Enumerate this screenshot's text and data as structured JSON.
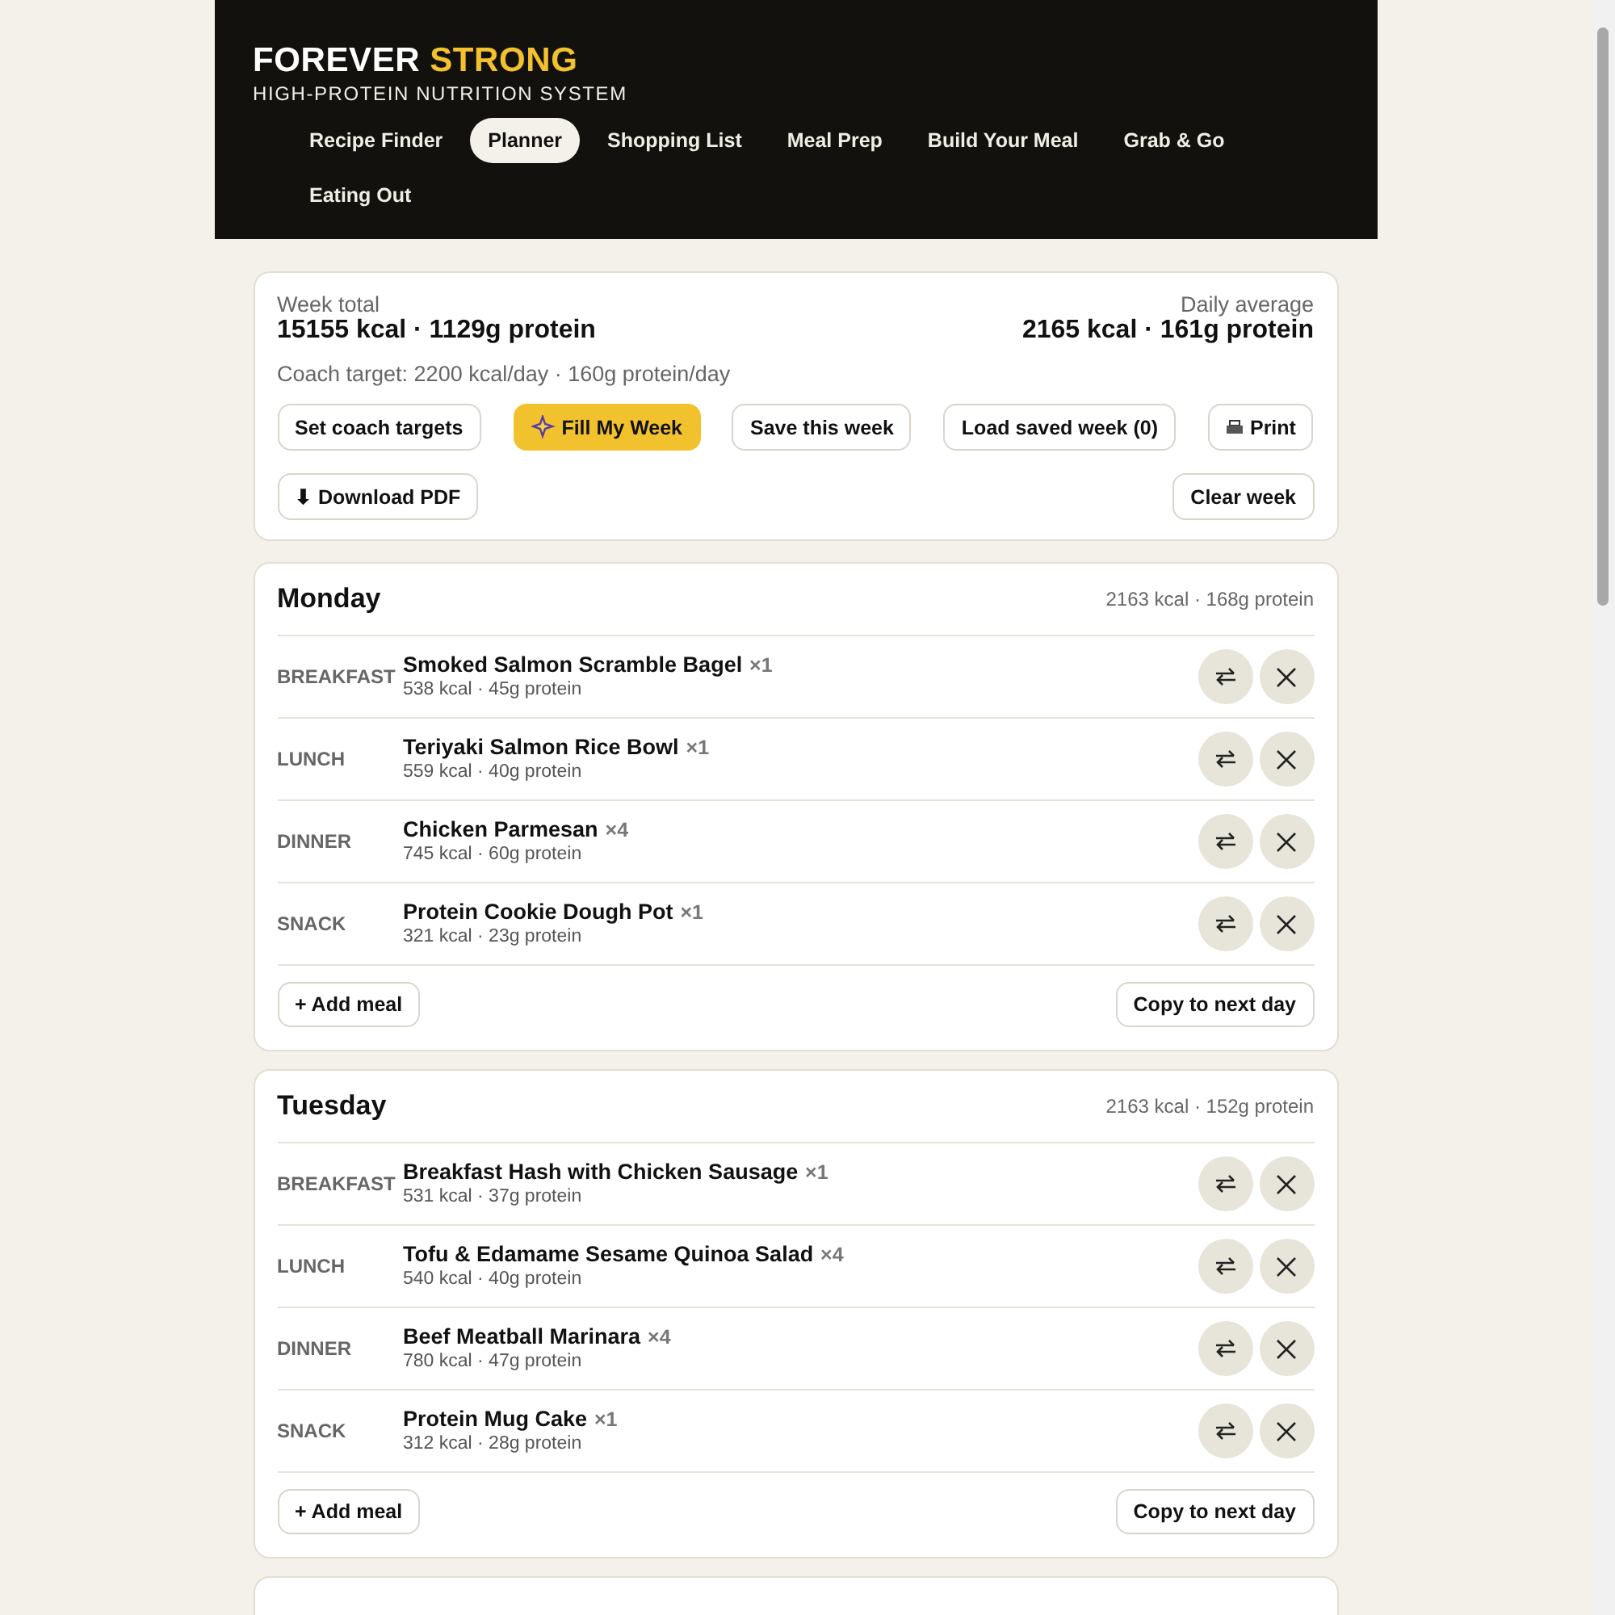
{
  "brand": {
    "title_main": "FOREVER",
    "title_accent": "STRONG",
    "tagline": "HIGH-PROTEIN NUTRITION SYSTEM"
  },
  "nav": [
    {
      "label": "Recipe Finder",
      "selected": false
    },
    {
      "label": "Planner",
      "selected": true
    },
    {
      "label": "Shopping List",
      "selected": false
    },
    {
      "label": "Meal Prep",
      "selected": false
    },
    {
      "label": "Build Your Meal",
      "selected": false
    },
    {
      "label": "Grab & Go",
      "selected": false
    },
    {
      "label": "Eating Out",
      "selected": false
    }
  ],
  "summary": {
    "week_label": "Week total",
    "week_value": "15155 kcal · 1129g protein",
    "avg_label": "Daily average",
    "avg_value": "2165 kcal · 161g protein",
    "coach_target": "Coach target: 2200 kcal/day · 160g protein/day",
    "buttons": [
      {
        "label": "Set coach targets",
        "kind": "plain"
      },
      {
        "label": "Fill My Week",
        "kind": "primary"
      },
      {
        "label": "Save this week",
        "kind": "plain"
      },
      {
        "label": "Load saved week (0)",
        "kind": "plain"
      },
      {
        "label": "Print",
        "kind": "print"
      },
      {
        "label": "⬇ Download PDF",
        "kind": "plain"
      },
      {
        "label": "Clear week",
        "kind": "plain"
      }
    ]
  },
  "days": [
    {
      "name": "Monday",
      "totals": "2163 kcal · 168g protein",
      "meals": [
        {
          "slot": "BREAKFAST",
          "name": "Smoked Salmon Scramble Bagel",
          "qty": "×1",
          "info": "538 kcal · 45g protein"
        },
        {
          "slot": "LUNCH",
          "name": "Teriyaki Salmon Rice Bowl",
          "qty": "×1",
          "info": "559 kcal · 40g protein"
        },
        {
          "slot": "DINNER",
          "name": "Chicken Parmesan",
          "qty": "×4",
          "info": "745 kcal · 60g protein"
        },
        {
          "slot": "SNACK",
          "name": "Protein Cookie Dough Pot",
          "qty": "×1",
          "info": "321 kcal · 23g protein"
        }
      ],
      "add_label": "+ Add meal",
      "copy_label": "Copy to next day"
    },
    {
      "name": "Tuesday",
      "totals": "2163 kcal · 152g protein",
      "meals": [
        {
          "slot": "BREAKFAST",
          "name": "Breakfast Hash with Chicken Sausage",
          "qty": "×1",
          "info": "531 kcal · 37g protein"
        },
        {
          "slot": "LUNCH",
          "name": "Tofu & Edamame Sesame Quinoa Salad",
          "qty": "×4",
          "info": "540 kcal · 40g protein"
        },
        {
          "slot": "DINNER",
          "name": "Beef Meatball Marinara",
          "qty": "×4",
          "info": "780 kcal · 47g protein"
        },
        {
          "slot": "SNACK",
          "name": "Protein Mug Cake",
          "qty": "×1",
          "info": "312 kcal · 28g protein"
        }
      ],
      "add_label": "+ Add meal",
      "copy_label": "Copy to next day"
    }
  ],
  "next_day_card_peek": true
}
